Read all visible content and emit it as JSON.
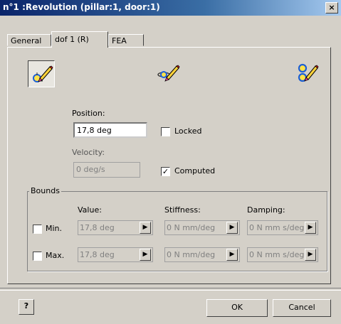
{
  "window": {
    "title": "n°1 :Revolution (pillar:1, door:1)",
    "close": "×"
  },
  "tabs": [
    {
      "label": "General"
    },
    {
      "label": "dof 1 (R)"
    },
    {
      "label": "FEA"
    }
  ],
  "dof": {
    "position_label": "Position:",
    "position_value": "17,8 deg",
    "locked_label": "Locked",
    "locked_checked": false,
    "velocity_label": "Velocity:",
    "velocity_value": "0 deg/s",
    "computed_label": "Computed",
    "computed_checked": true
  },
  "bounds": {
    "legend": "Bounds",
    "value_header": "Value:",
    "stiffness_header": "Stiffness:",
    "damping_header": "Damping:",
    "rows": [
      {
        "label": "Min.",
        "value": "17,8 deg",
        "stiffness": "0 N mm/deg",
        "damping": "0 N mm s/deg",
        "checked": false
      },
      {
        "label": "Max.",
        "value": "17,8 deg",
        "stiffness": "0 N mm/deg",
        "damping": "0 N mm s/deg",
        "checked": false
      }
    ]
  },
  "footer": {
    "help": "?",
    "ok": "OK",
    "cancel": "Cancel"
  },
  "colors": {
    "title_start": "#0a246a",
    "title_end": "#a6caf0",
    "face": "#d4d0c8"
  }
}
